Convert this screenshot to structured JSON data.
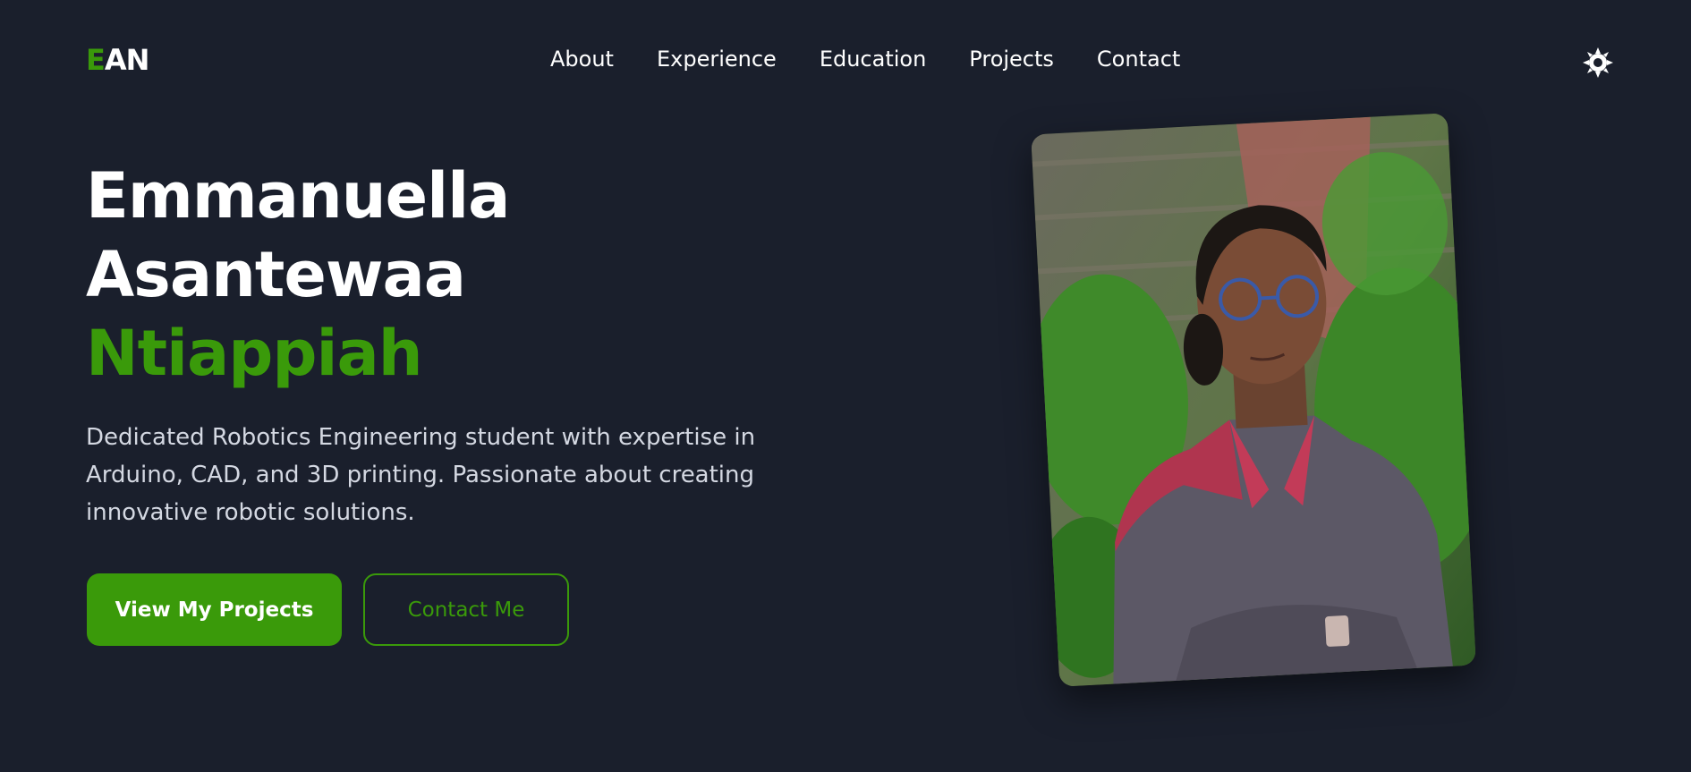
{
  "header": {
    "logo_accent": "E",
    "logo_rest": "AN",
    "nav": {
      "about": "About",
      "experience": "Experience",
      "education": "Education",
      "projects": "Projects",
      "contact": "Contact"
    },
    "theme_icon": "sun-icon"
  },
  "hero": {
    "name_line1": "Emmanuella",
    "name_line2": "Asantewaa",
    "name_line3": "Ntiappiah",
    "description": "Dedicated Robotics Engineering student with expertise in Arduino, CAD, and 3D printing. Passionate about creating innovative robotic solutions.",
    "primary_button": "View My Projects",
    "secondary_button": "Contact Me"
  },
  "portrait": {
    "image_content": "photo"
  },
  "colors": {
    "background": "#1a1f2c",
    "accent": "#3a9a0a",
    "text": "#ffffff",
    "muted_text": "#d4d8e2"
  }
}
